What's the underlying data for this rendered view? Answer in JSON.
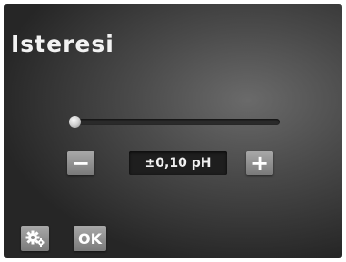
{
  "screen": {
    "title": "Isteresi"
  },
  "slider": {
    "level": 0.0
  },
  "stepper": {
    "minus_label": "−",
    "value": "±0,10 pH",
    "plus_label": "+"
  },
  "footer": {
    "settings_icon": "gears-icon",
    "ok_label": "OK"
  },
  "colors": {
    "background": "#4a4a4a",
    "button": "#8f8f8f",
    "text": "#f2f2f2"
  }
}
